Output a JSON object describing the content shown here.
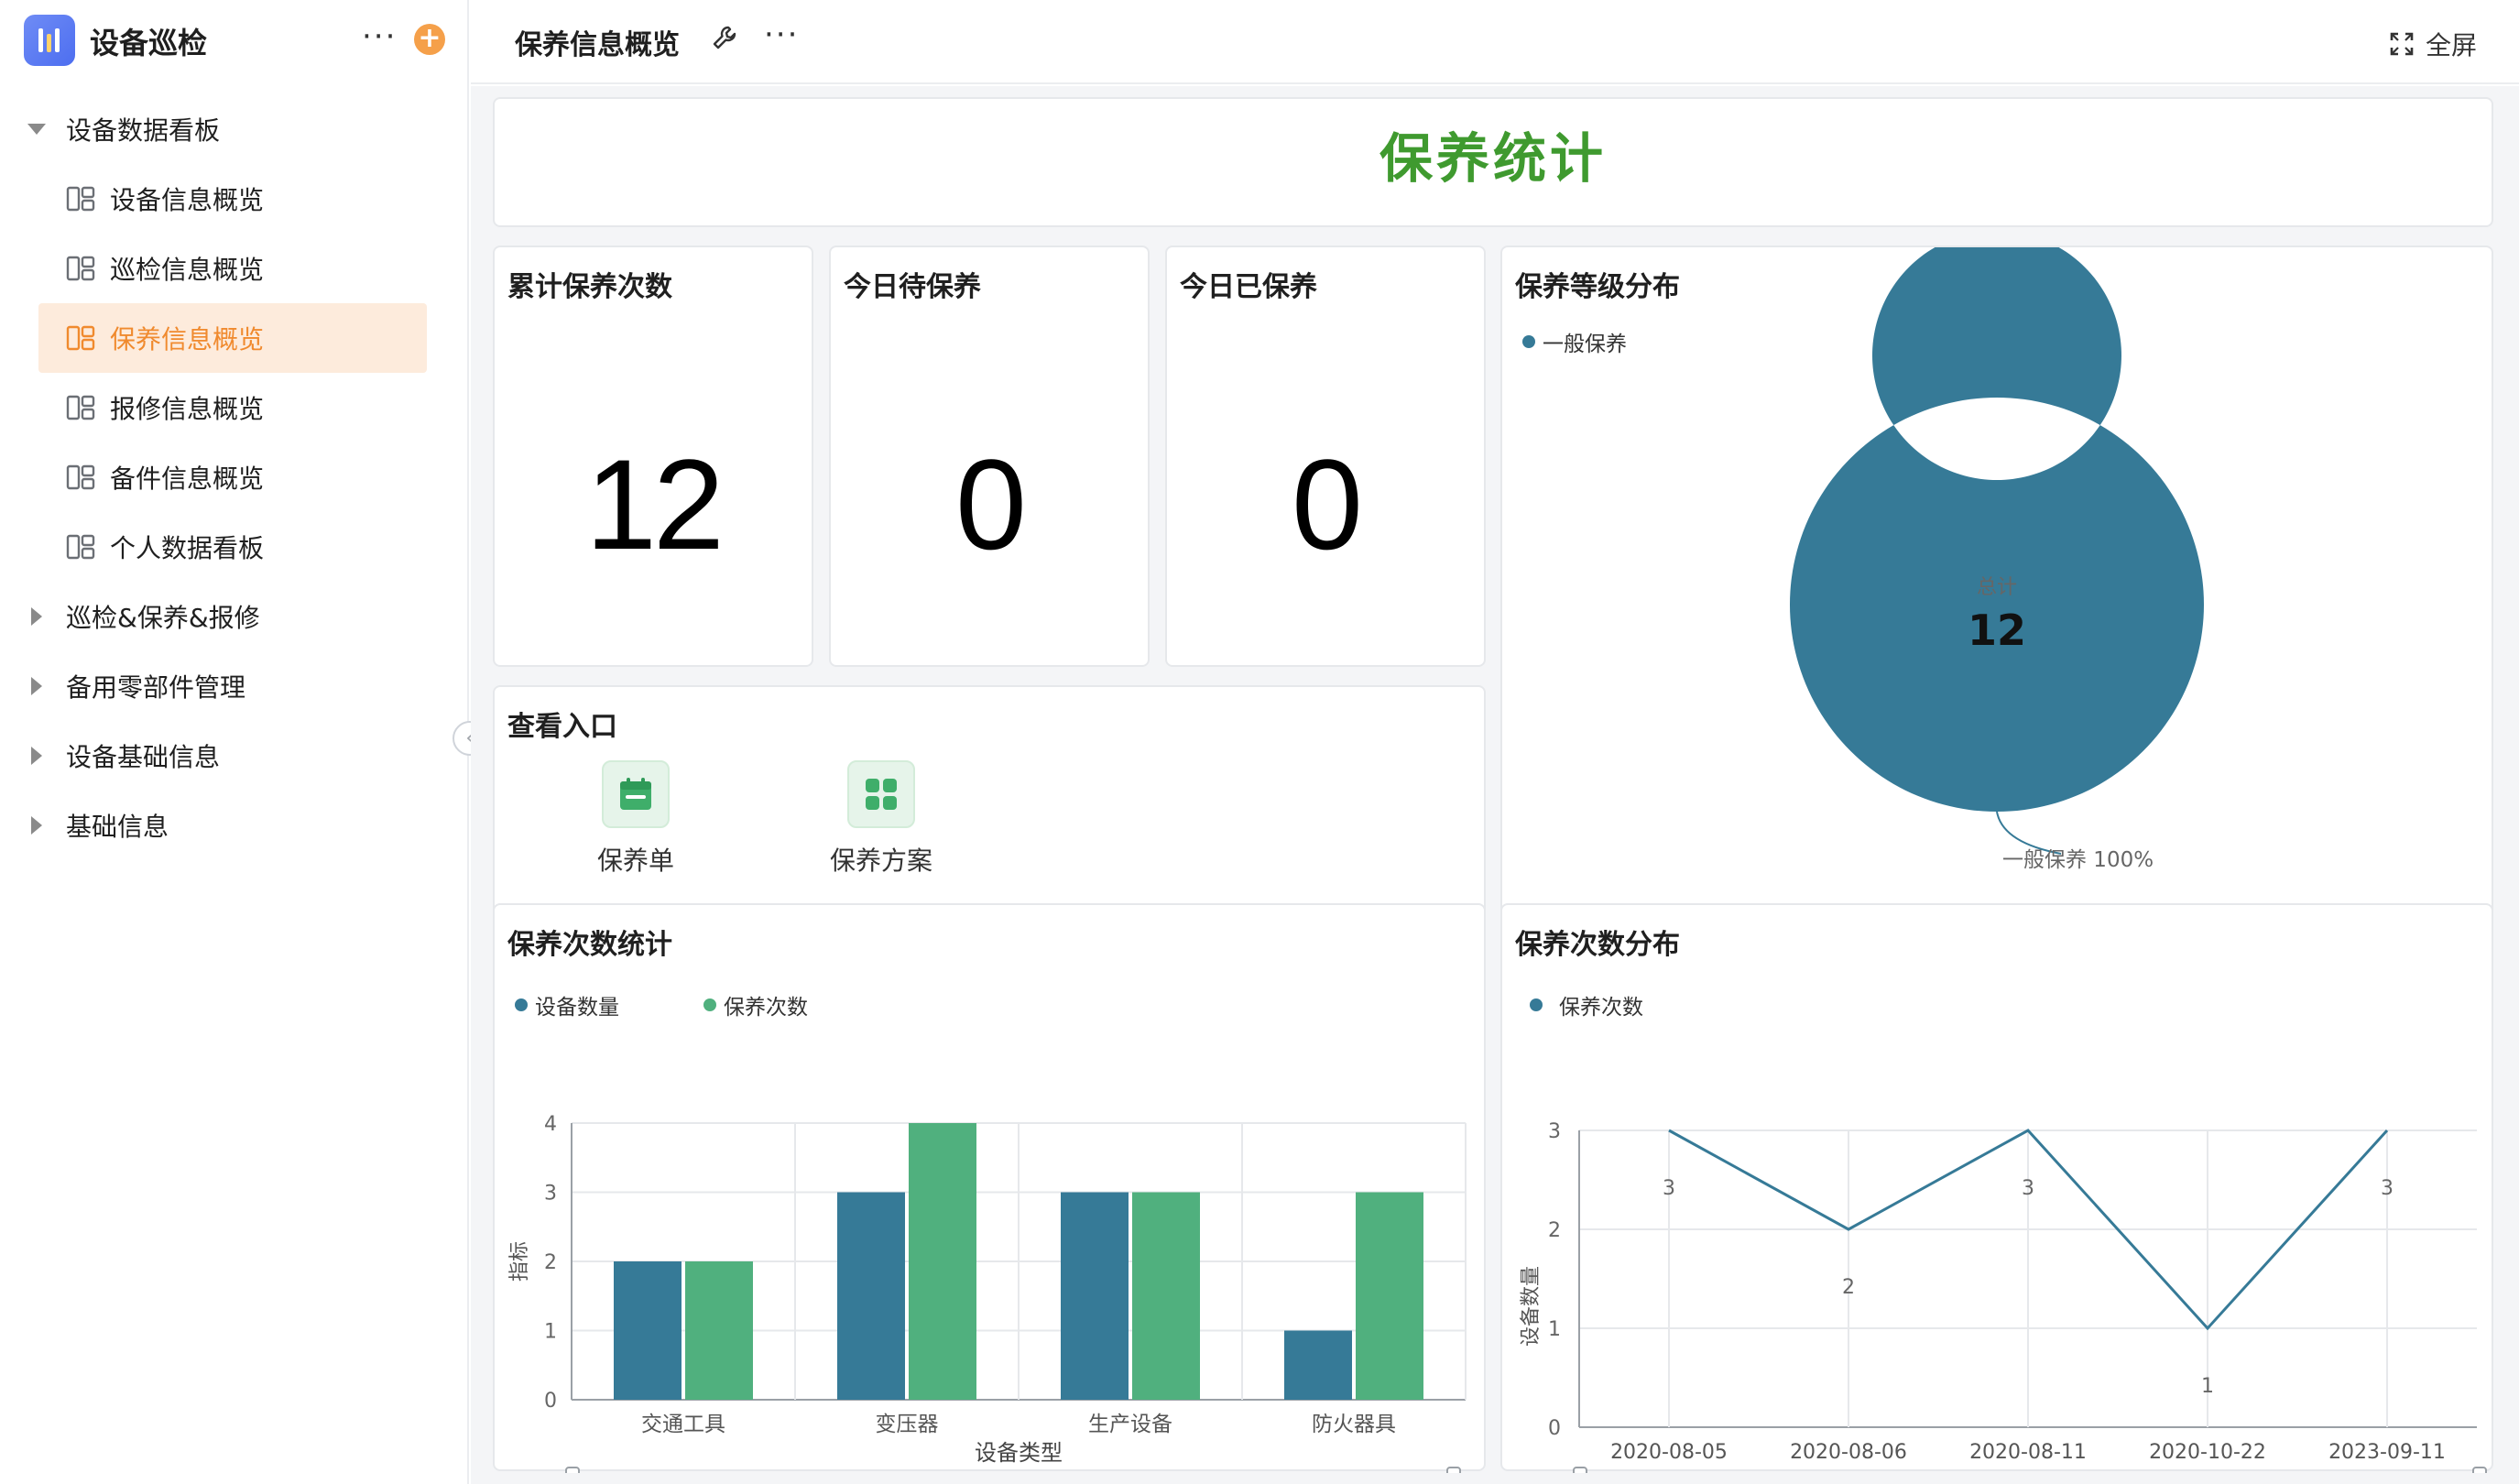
{
  "app": {
    "title": "设备巡检"
  },
  "sidebar": {
    "items": [
      {
        "label": "设备数据看板",
        "kind": "group-open"
      },
      {
        "label": "设备信息概览",
        "kind": "child"
      },
      {
        "label": "巡检信息概览",
        "kind": "child"
      },
      {
        "label": "保养信息概览",
        "kind": "child",
        "active": true
      },
      {
        "label": "报修信息概览",
        "kind": "child"
      },
      {
        "label": "备件信息概览",
        "kind": "child"
      },
      {
        "label": "个人数据看板",
        "kind": "child"
      },
      {
        "label": "巡检&保养&报修",
        "kind": "group"
      },
      {
        "label": "备用零部件管理",
        "kind": "group"
      },
      {
        "label": "设备基础信息",
        "kind": "group"
      },
      {
        "label": "基础信息",
        "kind": "group"
      }
    ]
  },
  "topbar": {
    "title": "保养信息概览",
    "fullscreen_label": "全屏"
  },
  "banner": {
    "title": "保养统计"
  },
  "kpis": [
    {
      "title": "累计保养次数",
      "value": "12"
    },
    {
      "title": "今日待保养",
      "value": "0"
    },
    {
      "title": "今日已保养",
      "value": "0"
    }
  ],
  "entries": {
    "title": "查看入口",
    "items": [
      {
        "label": "保养单"
      },
      {
        "label": "保养方案"
      }
    ]
  },
  "colors": {
    "accent": "#f08a2e",
    "series_blue": "#367a97",
    "series_green": "#50b07e",
    "banner_green": "#3f9a2f"
  },
  "chart_data": [
    {
      "type": "pie",
      "title": "保养等级分布",
      "legend": [
        "一般保养"
      ],
      "slices": [
        {
          "name": "一般保养",
          "value": 12,
          "percent": "100%",
          "label": "一般保养 100%"
        }
      ],
      "center_label": "总计",
      "center_value": "12"
    },
    {
      "type": "bar",
      "title": "保养次数统计",
      "categories": [
        "交通工具",
        "变压器",
        "生产设备",
        "防火器具"
      ],
      "series": [
        {
          "name": "设备数量",
          "values": [
            2,
            3,
            3,
            1
          ]
        },
        {
          "name": "保养次数",
          "values": [
            2,
            4,
            3,
            3
          ]
        }
      ],
      "xlabel": "设备类型",
      "ylabel": "指标",
      "ylim": [
        0,
        4
      ],
      "yticks": [
        "0",
        "1",
        "2",
        "3",
        "4"
      ],
      "zoom_start": "交通工具",
      "zoom_end": "防火器具"
    },
    {
      "type": "line",
      "title": "保养次数分布",
      "x": [
        "2020-08-05",
        "2020-08-06",
        "2020-08-11",
        "2020-10-22",
        "2023-09-11"
      ],
      "series": [
        {
          "name": "保养次数",
          "values": [
            3,
            2,
            3,
            1,
            3
          ]
        }
      ],
      "ylabel": "设备数量",
      "ylim": [
        0,
        3
      ],
      "yticks": [
        "0",
        "1",
        "2",
        "3"
      ],
      "zoom_start": "2020-08-05",
      "zoom_end": "2023-09-11"
    }
  ]
}
